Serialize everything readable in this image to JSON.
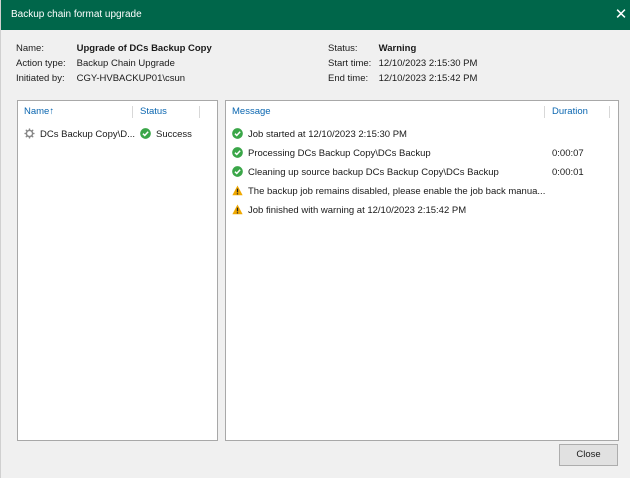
{
  "window": {
    "title": "Backup chain format upgrade",
    "close_glyph": "✕"
  },
  "summary": {
    "name_label": "Name:",
    "name_value": "Upgrade of DCs Backup Copy",
    "action_label": "Action type:",
    "action_value": "Backup Chain Upgrade",
    "initiated_label": "Initiated by:",
    "initiated_value": "CGY-HVBACKUP01\\csun",
    "status_label": "Status:",
    "status_value": "Warning",
    "start_label": "Start time:",
    "start_value": "12/10/2023 2:15:30 PM",
    "end_label": "End time:",
    "end_value": "12/10/2023 2:15:42 PM"
  },
  "objects": {
    "columns": {
      "name": "Name",
      "sort_arrow": "↑",
      "status": "Status"
    },
    "rows": [
      {
        "name": "DCs Backup Copy\\D...",
        "status": "Success",
        "icon": "gear-icon",
        "status_icon": "success-icon"
      }
    ]
  },
  "log": {
    "columns": {
      "message": "Message",
      "duration": "Duration"
    },
    "rows": [
      {
        "icon": "success-icon",
        "message": "Job started at 12/10/2023 2:15:30 PM",
        "duration": ""
      },
      {
        "icon": "success-icon",
        "message": "Processing DCs Backup Copy\\DCs Backup",
        "duration": "0:00:07"
      },
      {
        "icon": "success-icon",
        "message": "Cleaning up source backup DCs Backup Copy\\DCs Backup",
        "duration": "0:00:01"
      },
      {
        "icon": "warning-icon",
        "message": "The backup job remains disabled, please enable the job back manua...",
        "duration": ""
      },
      {
        "icon": "warning-icon",
        "message": "Job finished with warning at 12/10/2023 2:15:42 PM",
        "duration": ""
      }
    ]
  },
  "footer": {
    "close_label": "Close"
  },
  "colors": {
    "titlebar": "#00664a",
    "success": "#3aa648",
    "warning": "#f0a800",
    "header_link": "#0a66b0"
  }
}
